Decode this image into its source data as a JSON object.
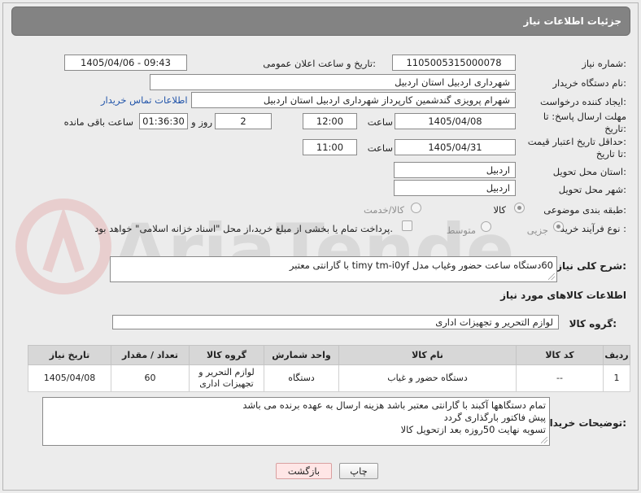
{
  "header": {
    "title": "جزئیات اطلاعات نیاز"
  },
  "form": {
    "need_number": {
      "label": "شماره نیاز:",
      "value": "1105005315000078"
    },
    "announce": {
      "label": "تاریخ و ساعت اعلان عمومی:",
      "value": "1405/04/06 - 09:43"
    },
    "buyer_org": {
      "label": "نام دستگاه خریدار:",
      "value": "شهرداری اردبیل استان اردبیل"
    },
    "creator": {
      "label": "ایجاد کننده درخواست:",
      "value": "شهرام پرویزی گندشمین کارپرداز شهرداری اردبیل استان اردبیل",
      "contact_link": "اطلاعات تماس خریدار"
    },
    "reply_deadline": {
      "label_line1": "مهلت ارسال پاسخ: تا",
      "label_line2": "تاریخ:",
      "date": "1405/04/08",
      "time_label": "ساعت",
      "time": "12:00",
      "days": "2",
      "days_label": "روز و",
      "remaining": "01:36:30",
      "remaining_label": "ساعت باقی مانده"
    },
    "price_validity": {
      "label_line1": "حداقل تاریخ اعتبار قیمت:",
      "label_line2": "تا تاریخ:",
      "date": "1405/04/31",
      "time_label": "ساعت",
      "time": "11:00"
    },
    "province": {
      "label": "استان محل تحویل:",
      "value": "اردبیل"
    },
    "city": {
      "label": "شهر محل تحویل:",
      "value": "اردبیل"
    },
    "category": {
      "label": "طبقه بندی موضوعی:",
      "opt1": "کالا",
      "opt2": "کالا/خدمت"
    },
    "purchase_type": {
      "label": "نوع فرآیند خرید :",
      "opt1": "جزیی",
      "opt2": "متوسط",
      "note": "پرداخت تمام یا بخشی از مبلغ خرید،از محل \"اسناد خزانه اسلامی\" خواهد بود."
    }
  },
  "description": {
    "label": "شرح کلی نیاز:",
    "value": "60دستگاه ساعت حضور وغیاب مدل timy tm-i0yf با گارانتی معتبر"
  },
  "goods_section": {
    "title": "اطلاعات کالاهای مورد نیاز",
    "group_label": "گروه کالا:",
    "group_value": "لوازم التحریر و تجهیزات اداری"
  },
  "table": {
    "headers": [
      "ردیف",
      "کد کالا",
      "نام کالا",
      "واحد شمارش",
      "گروه کالا",
      "تعداد / مقدار",
      "تاریخ نیاز"
    ],
    "rows": [
      {
        "row": "1",
        "code": "--",
        "name": "دستگاه حضور و غیاب",
        "unit": "دستگاه",
        "group_line1": "لوازم التحریر و",
        "group_line2": "تجهیزات اداری",
        "qty": "60",
        "date": "1405/04/08"
      }
    ]
  },
  "buyer_notes": {
    "label": "توضیحات خریدار:",
    "line1": "تمام دستگاهها آکبند با گارانتی معتبر باشد هزینه ارسال به عهده برنده می باشد",
    "line2": "پیش فاکتور بارگذاری گردد",
    "line3": "تسویه نهایت 50روزه بعد ازتحویل کالا"
  },
  "buttons": {
    "print": "چاپ",
    "back": "بازگشت"
  },
  "watermark": {
    "text": "AriaTender.net"
  }
}
